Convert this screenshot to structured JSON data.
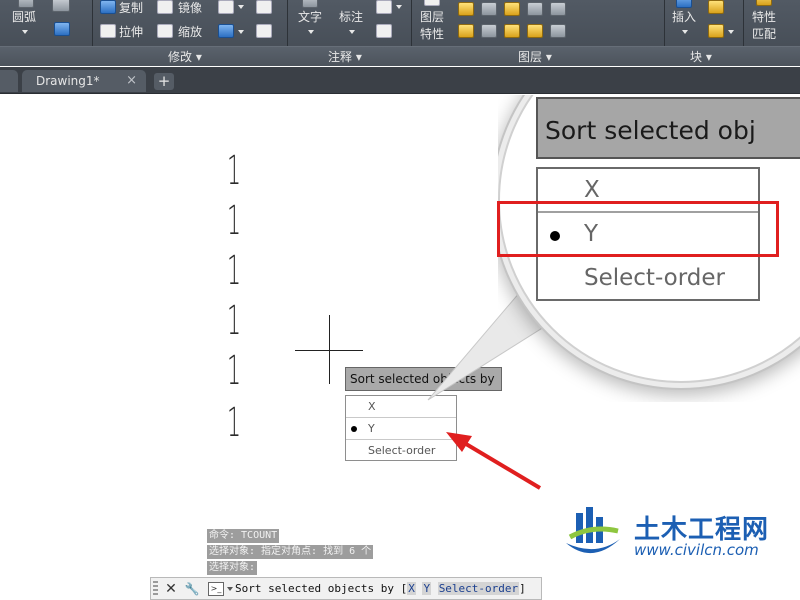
{
  "ribbon": {
    "draw_panel": {
      "arc_label": "圆弧"
    },
    "modify_panel": {
      "title": "修改",
      "copy_label": "复制",
      "mirror_label": "镜像",
      "stretch_label": "拉伸",
      "scale_label": "缩放"
    },
    "annotation_panel": {
      "title": "注释",
      "text_label": "文字",
      "dimension_label": "标注"
    },
    "layers_panel": {
      "title": "图层",
      "layer_props_label_1": "图层",
      "layer_props_label_2": "特性"
    },
    "block_panel": {
      "title": "块",
      "insert_label": "插入"
    },
    "properties_panel": {
      "match_label_1": "特性",
      "match_label_2": "匹配"
    }
  },
  "tabs": {
    "document_tab": "Drawing1*",
    "close_glyph": "×",
    "new_tab_glyph": "+"
  },
  "canvas": {
    "digits": [
      "1",
      "1",
      "1",
      "1",
      "1",
      "1"
    ]
  },
  "selection_menu": {
    "title": "Sort selected objects by",
    "options": [
      {
        "label": "X",
        "selected": false
      },
      {
        "label": "Y",
        "selected": true
      },
      {
        "label": "Select-order",
        "selected": false
      }
    ]
  },
  "magnifier": {
    "title": "Sort selected obj",
    "options": [
      {
        "label": "X",
        "selected": false
      },
      {
        "label": "Y",
        "selected": true
      },
      {
        "label": "Select-order",
        "selected": false
      }
    ],
    "highlight_color": "#e01f1f"
  },
  "command_line": {
    "history": [
      "命令: TCOUNT",
      "选择对象: 指定对角点: 找到 6 个",
      "选择对象:"
    ],
    "prompt_prefix": "Sort selected objects by [",
    "options": [
      "X",
      "Y",
      "Select-order"
    ],
    "prompt_suffix": "]",
    "close_glyph": "✕",
    "settings_glyph": "🔧",
    "prompt_icon_text": ">_"
  },
  "watermark": {
    "chinese": "土木工程网",
    "url": "www.civilcn.com",
    "brand_color": "#1c5fb3"
  },
  "colors": {
    "ribbon_bg": "#4b525b",
    "tabstrip_bg": "#3b4047",
    "arrow_red": "#e01f1f"
  }
}
